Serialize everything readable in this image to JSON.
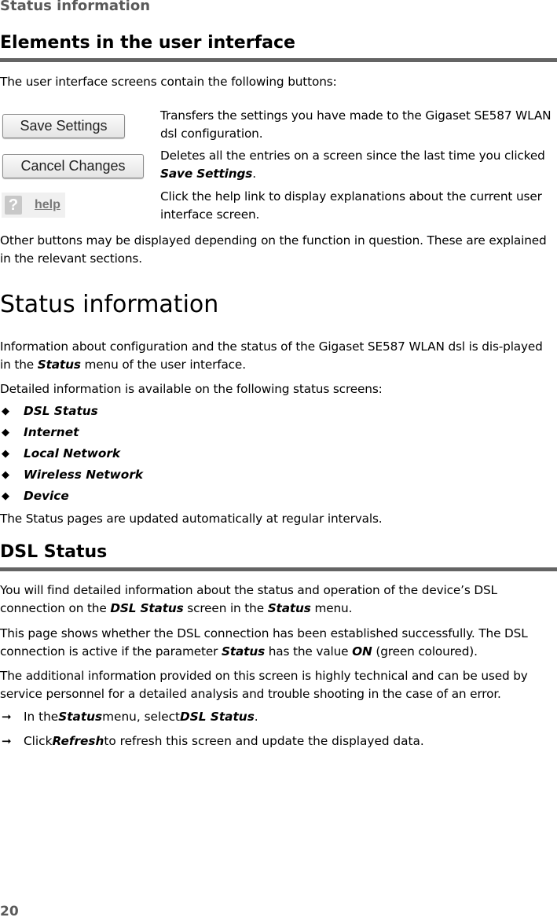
{
  "running_header": "Status information",
  "section1": {
    "title": "Elements in the user interface",
    "intro": "The user interface screens contain the following buttons:",
    "buttons": [
      {
        "label": "Save Settings",
        "desc_pre": "Transfers the settings you have made to the Gigaset SE587 WLAN dsl configuration.",
        "desc_bold": "",
        "desc_post": ""
      },
      {
        "label": "Cancel Changes",
        "desc_pre": "Deletes all the entries on a screen since the last time you clicked ",
        "desc_bold": "Save Settings",
        "desc_post": "."
      },
      {
        "label": "help",
        "icon": "?",
        "desc_pre": "Click the help link to display explanations about the current user interface screen.",
        "desc_bold": "",
        "desc_post": ""
      }
    ],
    "outro": "Other buttons may be displayed depending on the function in question. These are explained in the relevant sections."
  },
  "section2": {
    "title": "Status information",
    "p1_pre": "Information about configuration and the status of the Gigaset SE587 WLAN dsl is dis-played in the ",
    "p1_bold": "Status",
    "p1_post": " menu of the user interface.",
    "p2": "Detailed information is available on the following status screens:",
    "list": [
      "DSL Status",
      "Internet",
      "Local Network",
      "Wireless Network",
      "Device"
    ],
    "p3": "The Status pages are updated automatically at regular intervals."
  },
  "section3": {
    "title": "DSL Status",
    "p1_pre": "You will find detailed information about the status and operation of the device’s DSL connection on the ",
    "p1_b1": "DSL Status",
    "p1_mid": " screen in the ",
    "p1_b2": "Status",
    "p1_post": " menu.",
    "p2_pre": "This page shows whether the DSL connection has been established successfully. The DSL connection is active if the parameter ",
    "p2_b1": "Status",
    "p2_mid": " has the value ",
    "p2_b2": "ON",
    "p2_post": " (green coloured).",
    "p3": "The additional information provided on this screen is highly technical and can be used by service personnel for a detailed analysis and trouble shooting in the case of an error.",
    "steps": [
      {
        "pre": "In the ",
        "b1": "Status",
        "mid": " menu, select ",
        "b2": "DSL Status",
        "post": "."
      },
      {
        "pre": "Click ",
        "b1": "Refresh",
        "mid": " to refresh this screen and update the displayed data.",
        "b2": "",
        "post": ""
      }
    ]
  },
  "page_number": "20"
}
